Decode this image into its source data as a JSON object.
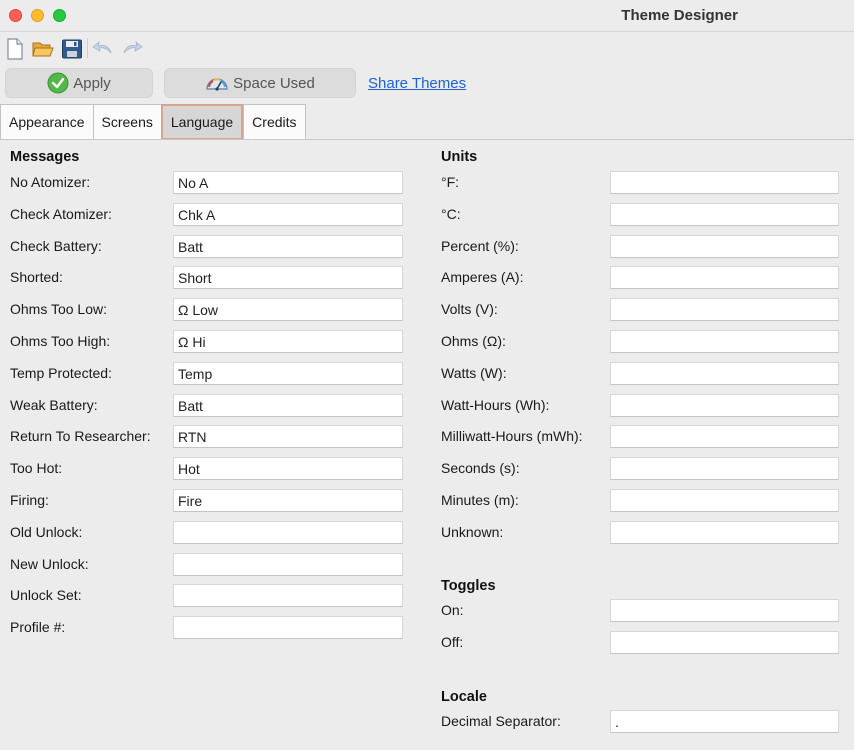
{
  "window": {
    "title": "Theme Designer"
  },
  "toolbar": {
    "icons": [
      "new-file-icon",
      "open-folder-icon",
      "save-icon",
      "undo-icon",
      "redo-icon"
    ]
  },
  "actions": {
    "apply_label": "Apply",
    "space_used_label": "Space Used",
    "share_themes_label": "Share Themes"
  },
  "tabs": [
    {
      "label": "Appearance",
      "active": false
    },
    {
      "label": "Screens",
      "active": false
    },
    {
      "label": "Language",
      "active": true
    },
    {
      "label": "Credits",
      "active": false
    }
  ],
  "messages": {
    "title": "Messages",
    "fields": [
      {
        "label": "No Atomizer:",
        "value": "No A"
      },
      {
        "label": "Check Atomizer:",
        "value": "Chk A"
      },
      {
        "label": "Check Battery:",
        "value": "Batt"
      },
      {
        "label": "Shorted:",
        "value": "Short"
      },
      {
        "label": "Ohms Too Low:",
        "value": "Ω Low"
      },
      {
        "label": "Ohms Too High:",
        "value": "Ω Hi"
      },
      {
        "label": "Temp Protected:",
        "value": "Temp"
      },
      {
        "label": "Weak Battery:",
        "value": "Batt"
      },
      {
        "label": "Return To Researcher:",
        "value": "RTN"
      },
      {
        "label": "Too Hot:",
        "value": "Hot"
      },
      {
        "label": "Firing:",
        "value": "Fire"
      },
      {
        "label": "Old Unlock:",
        "value": ""
      },
      {
        "label": "New Unlock:",
        "value": ""
      },
      {
        "label": "Unlock Set:",
        "value": ""
      },
      {
        "label": "Profile #:",
        "value": ""
      }
    ]
  },
  "units": {
    "title": "Units",
    "fields": [
      {
        "label": "°F:",
        "value": ""
      },
      {
        "label": "°C:",
        "value": ""
      },
      {
        "label": "Percent (%):",
        "value": ""
      },
      {
        "label": "Amperes (A):",
        "value": ""
      },
      {
        "label": "Volts (V):",
        "value": ""
      },
      {
        "label": "Ohms (Ω):",
        "value": ""
      },
      {
        "label": "Watts (W):",
        "value": ""
      },
      {
        "label": "Watt-Hours (Wh):",
        "value": ""
      },
      {
        "label": "Milliwatt-Hours (mWh):",
        "value": ""
      },
      {
        "label": "Seconds (s):",
        "value": ""
      },
      {
        "label": "Minutes (m):",
        "value": ""
      },
      {
        "label": "Unknown:",
        "value": ""
      }
    ]
  },
  "toggles": {
    "title": "Toggles",
    "fields": [
      {
        "label": "On:",
        "value": ""
      },
      {
        "label": "Off:",
        "value": ""
      }
    ]
  },
  "locale": {
    "title": "Locale",
    "fields": [
      {
        "label": "Decimal Separator:",
        "value": "."
      }
    ]
  }
}
